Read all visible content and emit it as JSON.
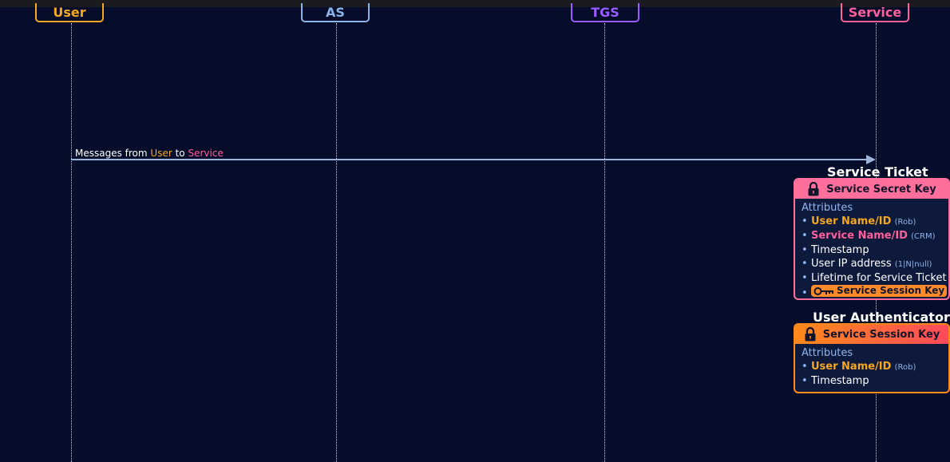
{
  "actors": {
    "user": {
      "label": "User",
      "color": "#f5a623"
    },
    "as": {
      "label": "AS",
      "color": "#8ab4e8"
    },
    "tgs": {
      "label": "TGS",
      "color": "#9b5cff"
    },
    "service": {
      "label": "Service",
      "color": "#ff5f9a"
    }
  },
  "message": {
    "prefix": "Messages from ",
    "from": "User",
    "mid": " to ",
    "to": "Service"
  },
  "service_ticket": {
    "title": "Service Ticket",
    "key_label": "Service Secret Key",
    "header_color": "#ff6f9c",
    "attributes_label": "Attributes",
    "items": [
      {
        "text": "User Name/ID",
        "note": "(Rob)"
      },
      {
        "text": "Service Name/ID",
        "note": "(CRM)"
      },
      {
        "text": "Timestamp",
        "note": ""
      },
      {
        "text": "User IP address",
        "note": "(1|N|null)"
      },
      {
        "text": "Lifetime for Service Ticket",
        "note": ""
      },
      {
        "text": "Service Session Key",
        "note": ""
      }
    ]
  },
  "user_authenticator": {
    "title": "User Authenticator",
    "key_label": "Service Session Key",
    "header_color_start": "#ff8a1a",
    "header_color_end": "#ff4a5a",
    "attributes_label": "Attributes",
    "items": [
      {
        "text": "User Name/ID",
        "note": "(Rob)"
      },
      {
        "text": "Timestamp",
        "note": ""
      }
    ]
  },
  "icons": [
    "lock-icon",
    "key-icon"
  ]
}
